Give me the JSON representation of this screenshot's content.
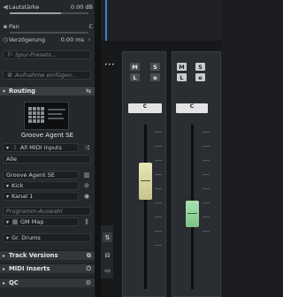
{
  "inspector": {
    "volume": {
      "label": "Lautstärke",
      "value": "0.00 dB"
    },
    "pan": {
      "label": "Pan",
      "value": "C"
    },
    "delay": {
      "label": "Verzögerung",
      "value": "0.00 ms"
    },
    "track_presets": "Spur-Presets...",
    "add_recording": "Aufnahme einfügen...",
    "routing_section": "Routing",
    "instrument_name": "Groove Agent SE",
    "midi_input": "All MIDI Inputs",
    "input_channel": "Alle",
    "output_instrument": "Groove Agent SE",
    "kit": "Kick",
    "channel": "Kanal 1",
    "program_select": "Programm-Auswahl",
    "map": "GM Map",
    "drum_map": "Gr. Drums",
    "sections": {
      "track_versions": "Track Versions",
      "midi_inserts": "MIDI Inserts",
      "qc": "QC"
    }
  },
  "mixer": {
    "more_label": "•••",
    "ch1": {
      "mute": "M",
      "solo": "S",
      "listen": "L",
      "edit": "e",
      "pan": "C"
    },
    "ch2": {
      "mute": "M",
      "solo": "S",
      "listen": "L",
      "edit": "e",
      "pan": "C"
    }
  },
  "colors": {
    "accent_blue": "#3d7fd4",
    "fader_yellow": "#d9d7a0",
    "fader_green": "#8fd39a"
  },
  "icons": [
    "speaker-icon",
    "pan-icon",
    "clock-icon",
    "preset-icon",
    "record-icon",
    "routing-icon",
    "midi-icon",
    "shuffle-icon",
    "instrument-icon",
    "edit-icon",
    "drum-icon",
    "settings-icon",
    "eq-icon"
  ]
}
